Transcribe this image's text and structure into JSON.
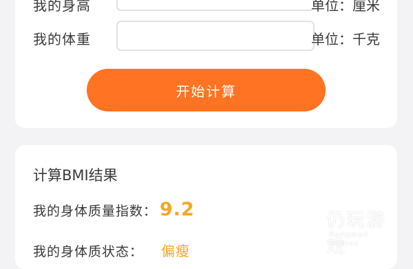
{
  "form": {
    "height_label": "我的身高",
    "height_unit": "单位：厘米",
    "weight_label": "我的体重",
    "weight_unit": "单位：千克",
    "start_button": "开始计算"
  },
  "result": {
    "title": "计算BMI结果",
    "bmi_label": "我的身体质量指数：",
    "bmi_value": "9.2",
    "state_label": "我的身体质状态：",
    "state_value": "偏瘦"
  },
  "watermark": {
    "name": "仍玩游戏",
    "sub": "Rengwan Games"
  },
  "colors": {
    "accent": "#ff7322",
    "value": "#f5a623"
  }
}
